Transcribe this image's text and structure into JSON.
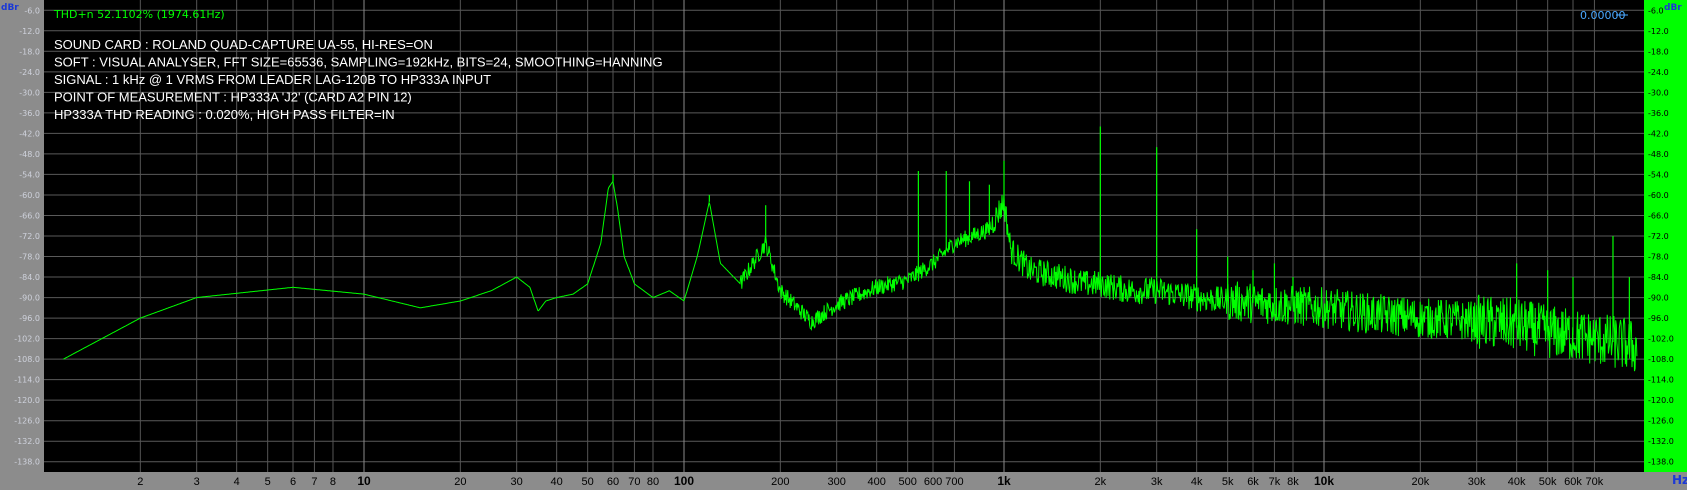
{
  "chart_data": {
    "type": "line",
    "x_scale": "log",
    "xlim": [
      1,
      100000
    ],
    "ylim": [
      -141,
      -3
    ],
    "grid": true,
    "y_ticks": [
      -6,
      -12,
      -18,
      -24,
      -30,
      -36,
      -42,
      -48,
      -54,
      -60,
      -66,
      -72,
      -78,
      -84,
      -90,
      -96,
      -102,
      -108,
      -114,
      -120,
      -126,
      -132,
      -138
    ],
    "x_ticks": [
      {
        "value": 2,
        "label": "2"
      },
      {
        "value": 3,
        "label": "3"
      },
      {
        "value": 4,
        "label": "4"
      },
      {
        "value": 5,
        "label": "5"
      },
      {
        "value": 6,
        "label": "6"
      },
      {
        "value": 7,
        "label": "7"
      },
      {
        "value": 8,
        "label": "8"
      },
      {
        "value": 10,
        "label": "10",
        "major": true
      },
      {
        "value": 20,
        "label": "20"
      },
      {
        "value": 30,
        "label": "30"
      },
      {
        "value": 40,
        "label": "40"
      },
      {
        "value": 50,
        "label": "50"
      },
      {
        "value": 60,
        "label": "60"
      },
      {
        "value": 70,
        "label": "70"
      },
      {
        "value": 80,
        "label": "80"
      },
      {
        "value": 100,
        "label": "100",
        "major": true
      },
      {
        "value": 200,
        "label": "200"
      },
      {
        "value": 300,
        "label": "300"
      },
      {
        "value": 400,
        "label": "400"
      },
      {
        "value": 500,
        "label": "500"
      },
      {
        "value": 600,
        "label": "600"
      },
      {
        "value": 700,
        "label": "700"
      },
      {
        "value": 1000,
        "label": "1k",
        "major": true
      },
      {
        "value": 2000,
        "label": "2k"
      },
      {
        "value": 3000,
        "label": "3k"
      },
      {
        "value": 4000,
        "label": "4k"
      },
      {
        "value": 5000,
        "label": "5k"
      },
      {
        "value": 6000,
        "label": "6k"
      },
      {
        "value": 7000,
        "label": "7k"
      },
      {
        "value": 8000,
        "label": "8k"
      },
      {
        "value": 10000,
        "label": "10k",
        "major": true
      },
      {
        "value": 20000,
        "label": "20k"
      },
      {
        "value": 30000,
        "label": "30k"
      },
      {
        "value": 40000,
        "label": "40k"
      },
      {
        "value": 50000,
        "label": "50k"
      },
      {
        "value": 60000,
        "label": "60k"
      },
      {
        "value": 70000,
        "label": "70k"
      }
    ],
    "y_unit_left": "dBr",
    "y_unit_right": "dBr",
    "x_unit": "Hz",
    "thd_readout": "THD+n 52.1102% (1974.61Hz)",
    "cursor_readout": "0.00000",
    "annotations": [
      "SOUND CARD : ROLAND QUAD-CAPTURE UA-55, HI-RES=ON",
      "SOFT : VISUAL ANALYSER, FFT SIZE=65536, SAMPLING=192kHz, BITS=24, SMOOTHING=HANNING",
      "SIGNAL : 1 kHz @ 1 VRMS FROM LEADER LAG-120B TO HP333A INPUT",
      "POINT OF MEASUREMENT : HP333A 'J2' (CARD A2 PIN 12)",
      "HP333A THD READING : 0.020%, HIGH PASS FILTER=IN"
    ],
    "series": [
      {
        "color": "#00ff00",
        "x": [
          1.15,
          2,
          3,
          6,
          10,
          15,
          20,
          25,
          30,
          33,
          35,
          37,
          40,
          45,
          50,
          55,
          58,
          60,
          62,
          65,
          70,
          80,
          90,
          100,
          110,
          120,
          130,
          150,
          180,
          200,
          250,
          300,
          400,
          500,
          600,
          700,
          800,
          900,
          1000,
          1050,
          1200,
          1500,
          1800,
          2000,
          2200,
          2500,
          3000,
          3500,
          4000,
          5000,
          7000,
          10000,
          15000,
          20000,
          30000,
          40000,
          50000,
          60000,
          70000,
          80000,
          90000,
          95000
        ],
        "y": [
          -108,
          -96,
          -90,
          -87,
          -89,
          -93,
          -91,
          -88,
          -84,
          -87,
          -94,
          -91,
          -90,
          -89,
          -86,
          -74,
          -58,
          -56,
          -64,
          -78,
          -86,
          -90,
          -88,
          -91,
          -78,
          -62,
          -80,
          -86,
          -74,
          -88,
          -97,
          -92,
          -87,
          -85,
          -80,
          -74,
          -72,
          -70,
          -62,
          -76,
          -82,
          -84,
          -86,
          -86,
          -87,
          -88,
          -88,
          -89,
          -90,
          -91,
          -92,
          -93,
          -95,
          -96,
          -97,
          -98,
          -100,
          -101,
          -102,
          -103,
          -104,
          -105
        ],
        "peaks": [
          {
            "x": 60,
            "y": -54
          },
          {
            "x": 120,
            "y": -60
          },
          {
            "x": 180,
            "y": -63
          },
          {
            "x": 540,
            "y": -53
          },
          {
            "x": 660,
            "y": -53
          },
          {
            "x": 780,
            "y": -56
          },
          {
            "x": 900,
            "y": -57
          },
          {
            "x": 1000,
            "y": -50
          },
          {
            "x": 2000,
            "y": -40
          },
          {
            "x": 3000,
            "y": -46
          },
          {
            "x": 4000,
            "y": -70
          },
          {
            "x": 5000,
            "y": -78
          },
          {
            "x": 6000,
            "y": -82
          },
          {
            "x": 7000,
            "y": -80
          },
          {
            "x": 8000,
            "y": -84
          },
          {
            "x": 40000,
            "y": -80
          },
          {
            "x": 50000,
            "y": -82
          },
          {
            "x": 60000,
            "y": -84
          },
          {
            "x": 80000,
            "y": -72
          },
          {
            "x": 90000,
            "y": -84
          }
        ]
      }
    ]
  }
}
